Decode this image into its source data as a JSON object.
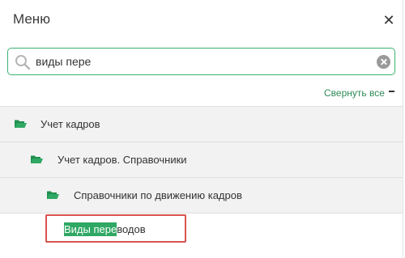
{
  "header": {
    "title": "Меню",
    "close_glyph": "✕"
  },
  "search": {
    "value": "виды пере",
    "placeholder": ""
  },
  "toolbar": {
    "collapse_all_label": "Свернуть все"
  },
  "tree": [
    {
      "label": "Учет кадров",
      "icon": "folder-open-icon"
    },
    {
      "label": "Учет кадров. Справочники",
      "icon": "folder-open-icon"
    },
    {
      "label": "Справочники по движению кадров",
      "icon": "folder-open-icon"
    }
  ],
  "result": {
    "match_text": "Виды пере",
    "rest_text": "водов"
  },
  "colors": {
    "accent": "#2fa864",
    "search_border": "#3bb273",
    "highlight_box": "#d9534f",
    "row_bg": "#f2f2f2"
  }
}
